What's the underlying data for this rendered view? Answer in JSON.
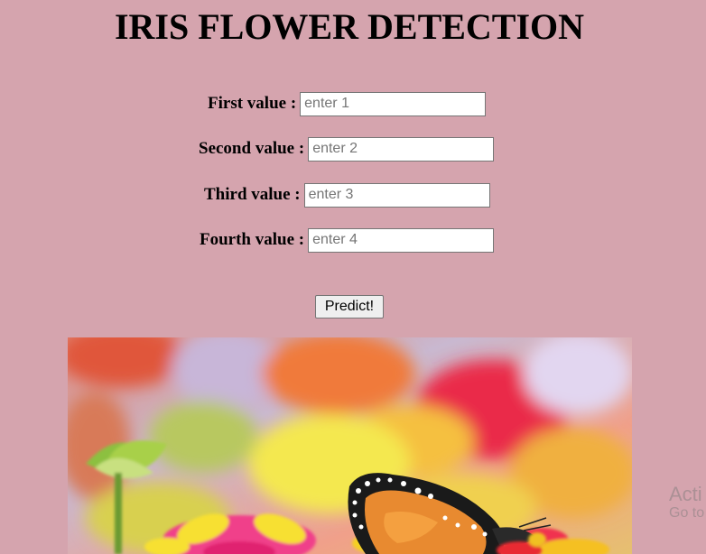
{
  "page": {
    "title": "IRIS FLOWER DETECTION"
  },
  "form": {
    "fields": [
      {
        "label": "First value :",
        "placeholder": "enter 1"
      },
      {
        "label": "Second value :",
        "placeholder": "enter 2"
      },
      {
        "label": "Third value :",
        "placeholder": "enter 3"
      },
      {
        "label": "Fourth value :",
        "placeholder": "enter 4"
      }
    ],
    "submit_label": "Predict!"
  },
  "image": {
    "description_icon": "flower-butterfly-image"
  },
  "watermark": {
    "line1": "Acti",
    "line2": "Go to"
  },
  "colors": {
    "background": "#d5a4ae"
  }
}
